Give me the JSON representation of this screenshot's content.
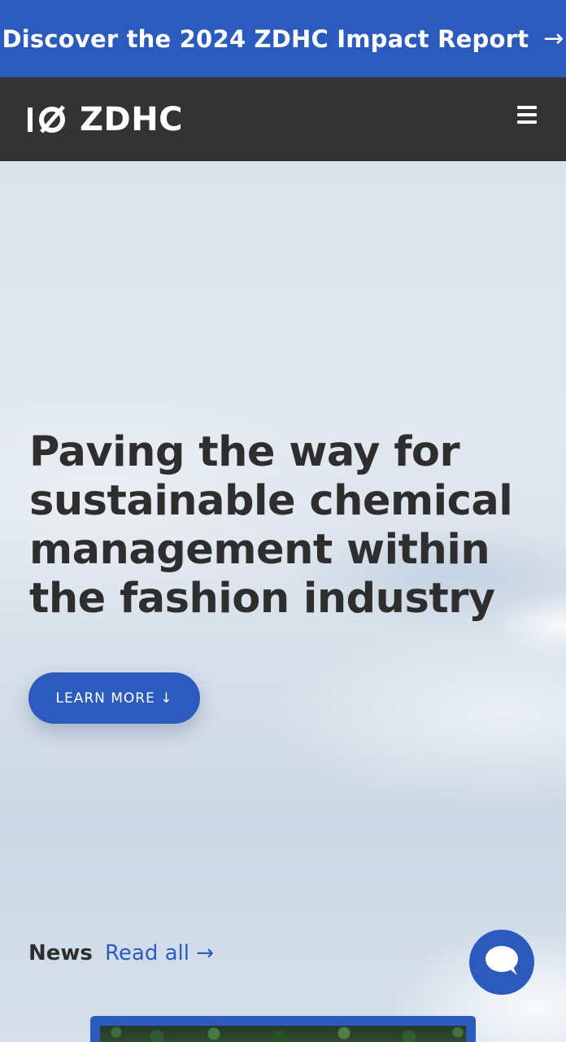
{
  "banner": {
    "text": "Discover the 2024 ZDHC Impact Report",
    "arrow": "→"
  },
  "navbar": {
    "logo_text": "ZDHC",
    "menu_icon": "hamburger-menu-icon"
  },
  "hero": {
    "headline": "Paving the way for sustainable chemical management within the fashion industry",
    "cta_label": "LEARN MORE ↓"
  },
  "news": {
    "heading": "News",
    "read_all_label": "Read all →"
  },
  "chat": {
    "icon": "chat-bubble-icon"
  },
  "colors": {
    "brand_blue": "#2b5bbd",
    "nav_dark": "#333333",
    "headline_text": "#2e2e2e"
  }
}
